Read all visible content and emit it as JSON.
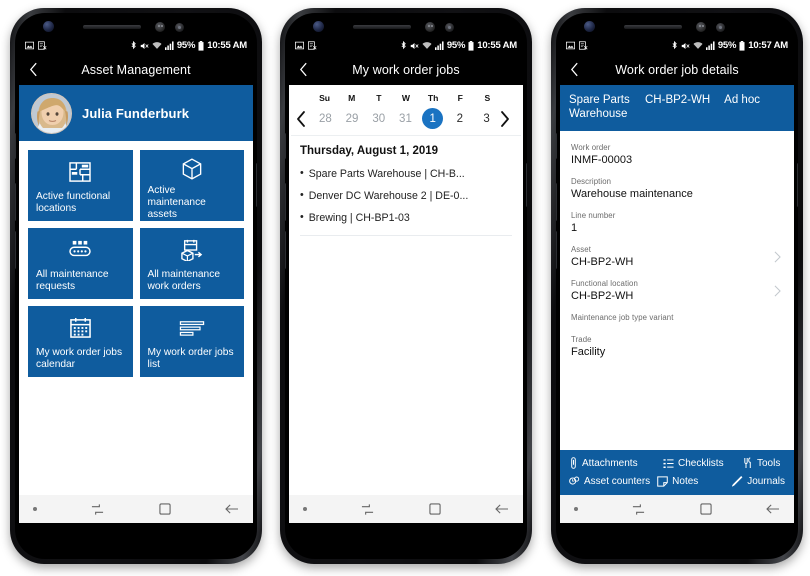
{
  "phones": [
    {
      "id": "asset-management",
      "status_bar": {
        "battery": "95%",
        "time": "10:55 AM"
      },
      "app_bar": {
        "title": "Asset Management",
        "back_icon": "chevron-left-icon"
      },
      "profile": {
        "name": "Julia Funderburk",
        "avatar_icon": "user-avatar"
      },
      "tiles": [
        {
          "label": "Active functional locations",
          "icon": "floorplan-icon"
        },
        {
          "label": "Active maintenance assets",
          "icon": "box-icon"
        },
        {
          "label": "All maintenance requests",
          "icon": "conveyor-icon"
        },
        {
          "label": "All maintenance work orders",
          "icon": "work-order-icon"
        },
        {
          "label": "My work order jobs calendar",
          "icon": "calendar-icon"
        },
        {
          "label": "My work order jobs list",
          "icon": "list-icon"
        }
      ]
    },
    {
      "id": "my-work-order-jobs",
      "status_bar": {
        "battery": "95%",
        "time": "10:55 AM"
      },
      "app_bar": {
        "title": "My work order jobs",
        "back_icon": "chevron-left-icon"
      },
      "calendar": {
        "day_names": [
          "Su",
          "M",
          "T",
          "W",
          "Th",
          "F",
          "S"
        ],
        "dates": [
          {
            "n": "28",
            "state": "other"
          },
          {
            "n": "29",
            "state": "other"
          },
          {
            "n": "30",
            "state": "other"
          },
          {
            "n": "31",
            "state": "other"
          },
          {
            "n": "1",
            "state": "selected"
          },
          {
            "n": "2",
            "state": "current"
          },
          {
            "n": "3",
            "state": "current"
          }
        ],
        "prev_icon": "chevron-left-icon",
        "next_icon": "chevron-right-icon"
      },
      "day_title": "Thursday, August 1, 2019",
      "jobs": [
        "Spare Parts Warehouse | CH-B...",
        "Denver DC Warehouse 2 | DE-0...",
        "Brewing | CH-BP1-03"
      ]
    },
    {
      "id": "work-order-job-details",
      "status_bar": {
        "battery": "95%",
        "time": "10:57 AM"
      },
      "app_bar": {
        "title": "Work order job details",
        "back_icon": "chevron-left-icon"
      },
      "pivots": [
        "Spare Parts Warehouse",
        "CH-BP2-WH",
        "Ad hoc"
      ],
      "fields": [
        {
          "label": "Work order",
          "value": "INMF-00003",
          "chevron": false
        },
        {
          "label": "Description",
          "value": "Warehouse maintenance",
          "chevron": false
        },
        {
          "label": "Line number",
          "value": "1",
          "chevron": false
        },
        {
          "label": "Asset",
          "value": "CH-BP2-WH",
          "chevron": true
        },
        {
          "label": "Functional location",
          "value": "CH-BP2-WH",
          "chevron": true
        },
        {
          "label": "Maintenance job type variant",
          "value": "",
          "chevron": false
        },
        {
          "label": "Trade",
          "value": "Facility",
          "chevron": false
        }
      ],
      "commands": [
        {
          "label": "Attachments",
          "icon": "paperclip-icon"
        },
        {
          "label": "Checklists",
          "icon": "checklist-icon"
        },
        {
          "label": "Tools",
          "icon": "tools-icon"
        },
        {
          "label": "Asset counters",
          "icon": "counter-icon"
        },
        {
          "label": "Notes",
          "icon": "note-icon"
        },
        {
          "label": "Journals",
          "icon": "pencil-icon"
        }
      ]
    }
  ],
  "nav_bar": {
    "items": [
      "dot-indicator",
      "recents-icon",
      "home-icon",
      "back-icon"
    ]
  },
  "status_icons": {
    "left": [
      "image-icon",
      "screenshot-icon"
    ],
    "right": [
      "bluetooth-icon",
      "mute-icon",
      "wifi-icon",
      "signal-icon"
    ]
  },
  "colors": {
    "brand_blue": "#0f5c9e",
    "selected_blue": "#1a73c2",
    "app_bar_black": "#000000",
    "nav_bar_gray": "#f4f4f4"
  }
}
